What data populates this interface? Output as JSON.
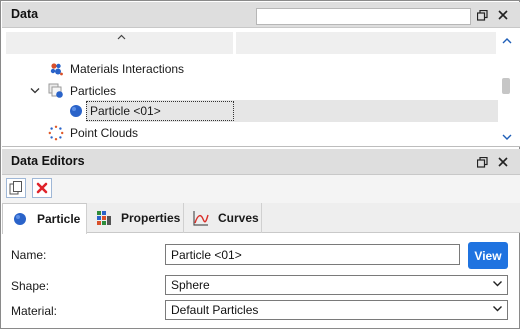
{
  "data_panel": {
    "title": "Data",
    "search": {
      "value": "",
      "placeholder": ""
    },
    "tree": [
      {
        "label": "Materials Interactions",
        "icon": "materials-interactions-icon"
      },
      {
        "label": "Particles",
        "icon": "particles-icon",
        "expanded": true
      },
      {
        "label": "Particle <01>",
        "icon": "particle-sphere-icon",
        "selected": true
      },
      {
        "label": "Point Clouds",
        "icon": "point-clouds-icon"
      }
    ]
  },
  "editors_panel": {
    "title": "Data Editors",
    "tabs": [
      {
        "label": "Particle",
        "icon": "particle-sphere-icon",
        "active": true
      },
      {
        "label": "Properties",
        "icon": "properties-grid-icon",
        "active": false
      },
      {
        "label": "Curves",
        "icon": "curves-chart-icon",
        "active": false
      }
    ],
    "form": {
      "name_label": "Name:",
      "name_value": "Particle <01>",
      "view_label": "View",
      "shape_label": "Shape:",
      "shape_value": "Sphere",
      "material_label": "Material:",
      "material_value": "Default Particles"
    }
  },
  "colors": {
    "accent": "#1f73e0",
    "header_bg": "#dedede",
    "selection": "#e6e6e6",
    "delete_red": "#e0242b"
  }
}
